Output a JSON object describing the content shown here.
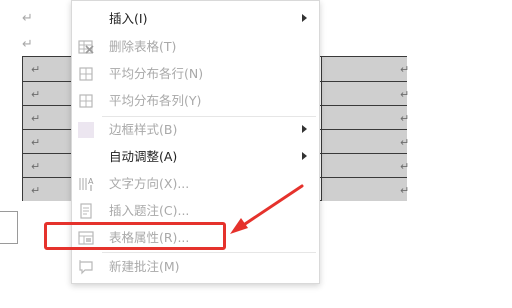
{
  "document": {
    "paragraph_mark": "↵",
    "table_rows": 6,
    "cell_mark": "↵"
  },
  "context_menu": {
    "items": [
      {
        "label": "插入(I)",
        "icon": "none",
        "disabled": false,
        "submenu": true
      },
      {
        "label": "删除表格(T)",
        "icon": "delete-table-icon",
        "disabled": true,
        "submenu": false
      },
      {
        "label": "平均分布各行(N)",
        "icon": "distribute-rows-icon",
        "disabled": true,
        "submenu": false
      },
      {
        "label": "平均分布各列(Y)",
        "icon": "distribute-columns-icon",
        "disabled": true,
        "submenu": false
      },
      {
        "label": "边框样式(B)",
        "icon": "border-style-icon",
        "disabled": true,
        "submenu": true
      },
      {
        "label": "自动调整(A)",
        "icon": "none",
        "disabled": false,
        "submenu": true
      },
      {
        "label": "文字方向(X)...",
        "icon": "text-direction-icon",
        "disabled": true,
        "submenu": false
      },
      {
        "label": "插入题注(C)...",
        "icon": "insert-caption-icon",
        "disabled": true,
        "submenu": false
      },
      {
        "label": "表格属性(R)...",
        "icon": "table-properties-icon",
        "disabled": true,
        "submenu": false
      },
      {
        "label": "新建批注(M)",
        "icon": "new-comment-icon",
        "disabled": true,
        "submenu": false
      }
    ]
  },
  "annotation": {
    "color": "#e5322c",
    "highlighted_item": "表格属性(R)..."
  }
}
